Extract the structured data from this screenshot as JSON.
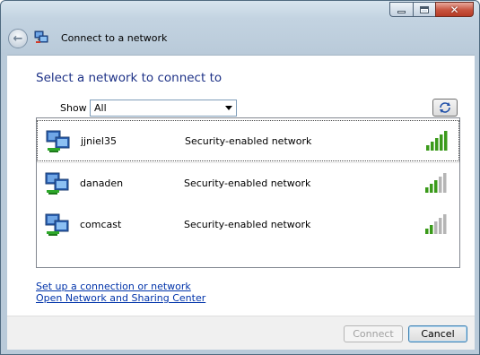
{
  "window": {
    "title": "Connect to a network",
    "caption_buttons": [
      "minimize",
      "maximize",
      "close"
    ]
  },
  "main": {
    "heading": "Select a network to connect to",
    "show_label": "Show",
    "show_value": "All",
    "networks": [
      {
        "name": "jjniel35",
        "security": "Security-enabled network",
        "signal_bars": 5,
        "selected": true
      },
      {
        "name": "danaden",
        "security": "Security-enabled network",
        "signal_bars": 3,
        "selected": false
      },
      {
        "name": "comcast",
        "security": "Security-enabled network",
        "signal_bars": 2,
        "selected": false
      }
    ],
    "links": {
      "setup": "Set up a connection or network",
      "sharing_center": "Open Network and Sharing Center"
    }
  },
  "footer": {
    "connect_label": "Connect",
    "cancel_label": "Cancel"
  },
  "colors": {
    "heading": "#1e3287",
    "link": "#0033aa",
    "signal_on": "#3a9a1a",
    "signal_off": "#b5b5b5"
  },
  "icons": [
    "back-arrow-icon",
    "network-icon",
    "refresh-icon",
    "signal-strength-icon",
    "dropdown-arrow-icon"
  ]
}
